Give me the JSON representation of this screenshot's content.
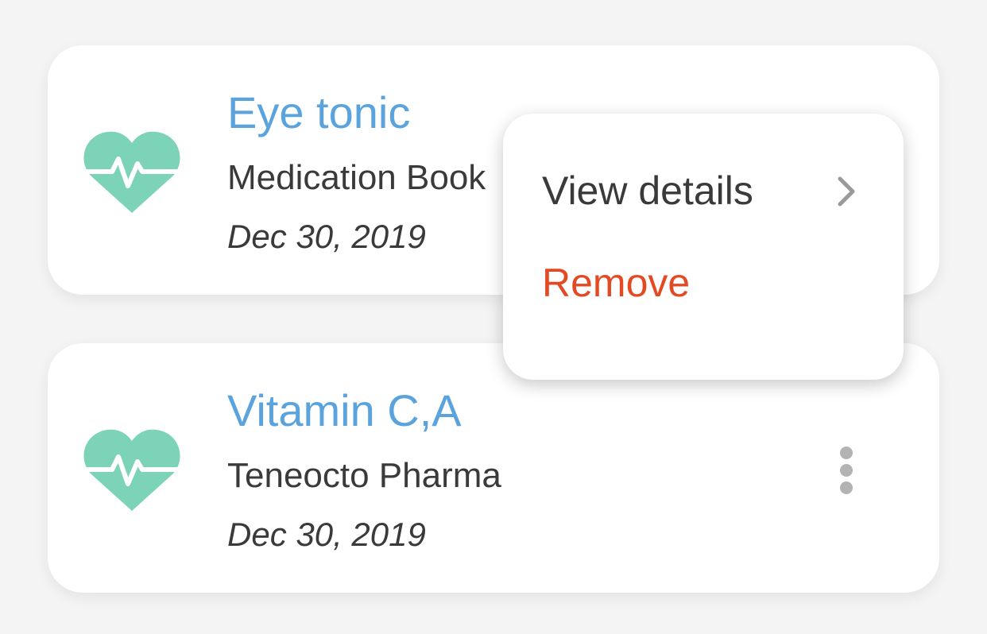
{
  "colors": {
    "background": "#f4f4f4",
    "card": "#ffffff",
    "title": "#5ba3dc",
    "text": "#3a3a3a",
    "heart": "#7dd3b7",
    "remove": "#e34a24",
    "kebab": "#b3b3b3"
  },
  "medications": [
    {
      "icon": "heart-pulse-icon",
      "name": "Eye tonic",
      "company": "Medication Book",
      "date": "Dec 30, 2019"
    },
    {
      "icon": "heart-pulse-icon",
      "name": "Vitamin C,A",
      "company": "Teneocto Pharma",
      "date": "Dec 30, 2019"
    }
  ],
  "context_menu": {
    "view_details_label": "View details",
    "view_details_icon": "chevron-right-icon",
    "remove_label": "Remove"
  },
  "more_icon": "more-vertical-icon"
}
